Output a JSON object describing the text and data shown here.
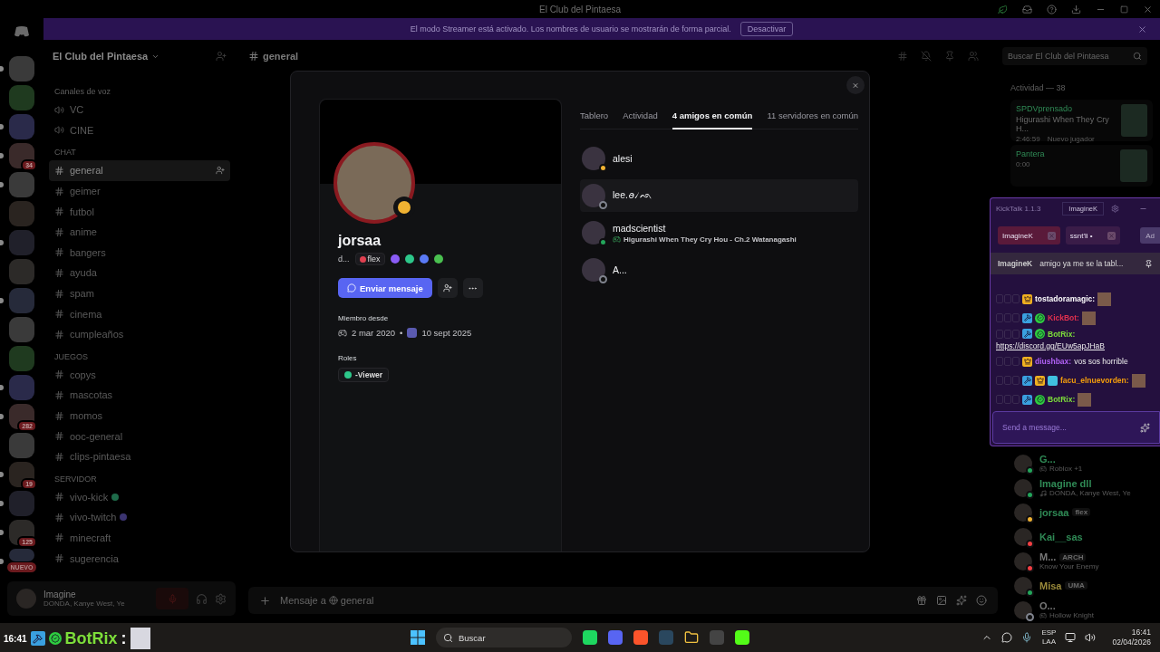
{
  "window": {
    "title": "El Club del Pintaesa"
  },
  "streamer_banner": {
    "text": "El modo Streamer está activado. Los nombres de usuario se mostrarán de forma parcial.",
    "button": "Desactivar"
  },
  "server_rail": [
    {
      "kind": "server",
      "unread": true
    },
    {
      "kind": "server",
      "unread": false
    },
    {
      "kind": "server",
      "unread": true
    },
    {
      "kind": "server",
      "unread": true,
      "badge": "34"
    },
    {
      "kind": "server",
      "unread": true
    },
    {
      "kind": "server",
      "unread": false
    },
    {
      "kind": "server",
      "unread": true
    },
    {
      "kind": "server",
      "unread": false
    },
    {
      "kind": "server",
      "unread": true
    },
    {
      "kind": "server",
      "unread": false
    },
    {
      "kind": "server",
      "unread": false
    },
    {
      "kind": "server",
      "unread": true
    },
    {
      "kind": "server",
      "unread": true,
      "badge": "282"
    },
    {
      "kind": "server",
      "unread": false
    },
    {
      "kind": "server",
      "unread": true,
      "badge": "19"
    },
    {
      "kind": "server",
      "unread": true
    },
    {
      "kind": "server",
      "unread": true,
      "badge": "125"
    },
    {
      "kind": "new",
      "unread": true,
      "badge": "NUEVO"
    }
  ],
  "sidebar": {
    "server_name": "El Club del Pintaesa",
    "categories": [
      {
        "name": "Canales de voz",
        "channels": [
          {
            "name": "VC",
            "kind": "voice",
            "selected": false
          },
          {
            "name": "CINE",
            "kind": "voice",
            "selected": false
          }
        ]
      },
      {
        "name": "CHAT",
        "channels": [
          {
            "name": "general",
            "kind": "text",
            "selected": true
          },
          {
            "name": "geimer",
            "kind": "text",
            "selected": false
          },
          {
            "name": "futbol",
            "kind": "text",
            "selected": false
          },
          {
            "name": "anime",
            "kind": "text",
            "selected": false
          },
          {
            "name": "bangers",
            "kind": "text",
            "selected": false
          },
          {
            "name": "ayuda",
            "kind": "text",
            "selected": false
          },
          {
            "name": "spam",
            "kind": "text",
            "selected": false
          },
          {
            "name": "cinema",
            "kind": "text",
            "selected": false
          },
          {
            "name": "cumpleaños",
            "kind": "text",
            "selected": false
          }
        ]
      },
      {
        "name": "JUEGOS",
        "channels": [
          {
            "name": "copys",
            "kind": "text",
            "selected": false
          },
          {
            "name": "mascotas",
            "kind": "text",
            "selected": false
          },
          {
            "name": "momos",
            "kind": "text",
            "selected": false
          },
          {
            "name": "ooc-general",
            "kind": "text",
            "selected": false
          },
          {
            "name": "clips-pintaesa",
            "kind": "text",
            "selected": false
          }
        ]
      },
      {
        "name": "SERVIDOR",
        "channels": [
          {
            "name": "vivo-kick",
            "kind": "text",
            "selected": false,
            "color": "#1e6b4a"
          },
          {
            "name": "vivo-twitch",
            "kind": "text",
            "selected": false,
            "color": "#3b3470"
          },
          {
            "name": "minecraft",
            "kind": "text",
            "selected": false
          },
          {
            "name": "sugerencia",
            "kind": "text",
            "selected": false
          }
        ]
      }
    ],
    "user": {
      "name": "Imagine",
      "activity": "DONDA, Kanye West, Ye"
    }
  },
  "chat": {
    "channel": "general",
    "search_placeholder": "Buscar El Club del Pintaesa",
    "input_prefix": "Mensaje a",
    "input_channel": "general"
  },
  "members": {
    "activity_header": "Actividad — 38",
    "activities": [
      {
        "title": "SPDVprensado",
        "game": "Higurashi When They Cry H...",
        "meta": [
          "2:46:59",
          "Nuevo jugador"
        ]
      },
      {
        "title": "Pantera",
        "meta": [
          "0:00"
        ]
      }
    ],
    "list": [
      {
        "name": "G...",
        "color": "#2f8a55",
        "presence": {
          "kind": "online"
        },
        "activity": {
          "kind": "game",
          "text": "Roblox +1"
        }
      },
      {
        "name": "Imagine dll",
        "color": "#2f8a55",
        "presence": {
          "kind": "online"
        },
        "activity": {
          "kind": "music",
          "text": "DONDA, Kanye West, Ye"
        }
      },
      {
        "name": "jorsaa",
        "color": "#2f8a55",
        "presence": {
          "kind": "idle"
        },
        "tag": "flex"
      },
      {
        "name": "Kai__sas",
        "color": "#2f8a55",
        "presence": {
          "kind": "dnd"
        }
      },
      {
        "name": "M...",
        "color": "#777777",
        "presence": {
          "kind": "dnd"
        },
        "tag": "ARCH",
        "activity": {
          "kind": "plain",
          "text": "Know Your Enemy"
        }
      },
      {
        "name": "Misa",
        "color": "#9a8a3a",
        "presence": {
          "kind": "online"
        },
        "tag": "UMA"
      },
      {
        "name": "O...",
        "color": "#777777",
        "presence": {
          "kind": "offline"
        },
        "activity": {
          "kind": "game",
          "text": "Hollow Knight"
        }
      }
    ]
  },
  "modal": {
    "profile": {
      "name": "jorsaa",
      "handle": "d...",
      "tag": "flex",
      "presence": {
        "kind": "idle"
      },
      "send_button": "Enviar mensaje",
      "member_since_label": "Miembro desde",
      "discord_date": "2 mar 2020",
      "separator": "•",
      "server_date": "10 sept 2025",
      "roles_label": "Roles",
      "roles": [
        {
          "name": "-Viewer",
          "color": "#2dc78a"
        }
      ]
    },
    "tabs": [
      {
        "label": "Tablero",
        "selected": false
      },
      {
        "label": "Actividad",
        "selected": false
      },
      {
        "label": "4 amigos en común",
        "selected": true
      },
      {
        "label": "11 servidores en común",
        "selected": false
      }
    ],
    "friends": [
      {
        "name": "alesi",
        "presence": {
          "kind": "idle"
        },
        "hovered": false
      },
      {
        "name": "lee.ꪮ৴ᨒ",
        "presence": {
          "kind": "offline"
        },
        "hovered": true
      },
      {
        "name": "madscientist",
        "presence": {
          "kind": "online"
        },
        "hovered": false,
        "activity": "Higurashi When They Cry Hou - Ch.2 Watanagashi"
      },
      {
        "name": "A...",
        "presence": {
          "kind": "offline"
        },
        "hovered": false
      }
    ]
  },
  "kicktalk": {
    "title": "KickTalk 1.1.3",
    "account_tab": "ImagineK",
    "chats": [
      {
        "name": "ImagineK",
        "selected": true
      },
      {
        "name": "ssnt'li •",
        "selected": false
      }
    ],
    "add_button": "Ad",
    "pinned": {
      "user": "ImagineK",
      "text": "amigo ya me se la tabl..."
    },
    "messages": [
      {
        "user": "tostadoramagic:",
        "color": "#ffffff",
        "badges": [
          {
            "kind": "vip"
          }
        ],
        "emote": true
      },
      {
        "user": "KickBot:",
        "color": "#e0304e",
        "badges": [
          {
            "kind": "mod"
          },
          {
            "kind": "verified"
          }
        ],
        "emote": true
      },
      {
        "user": "BotRix:",
        "color": "#7dde3a",
        "badges": [
          {
            "kind": "mod"
          },
          {
            "kind": "verified"
          }
        ],
        "link": "https://discord.gg/EUw5apJHaB"
      },
      {
        "user": "diushbax:",
        "color": "#b061f5",
        "badges": [
          {
            "kind": "vip"
          }
        ],
        "text": "vos sos horrible"
      },
      {
        "user": "facu_elnuevorden:",
        "color": "#f59e0b",
        "badges": [
          {
            "kind": "mod"
          },
          {
            "kind": "vip"
          },
          {
            "kind": "sub"
          }
        ],
        "emote": true
      },
      {
        "user": "BotRix:",
        "color": "#7dde3a",
        "badges": [
          {
            "kind": "mod"
          },
          {
            "kind": "verified"
          }
        ],
        "emote": true
      }
    ],
    "input_placeholder": "Send a message..."
  },
  "chat_overlay": {
    "time": "16:41",
    "user": "BotRix",
    "separator": ":"
  },
  "taskbar": {
    "search": "Buscar",
    "language": "ESP",
    "layout": "LAA",
    "time": "16:41",
    "date": "02/04/2026"
  }
}
